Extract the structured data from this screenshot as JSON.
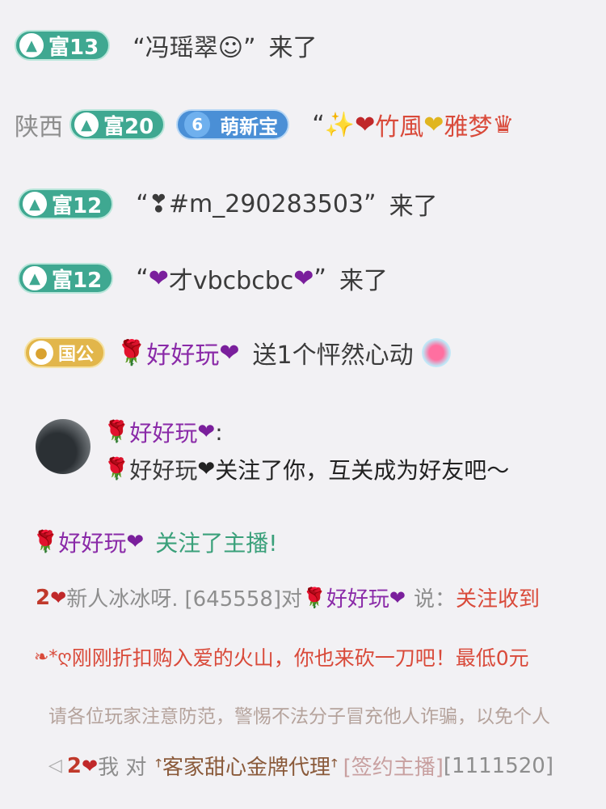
{
  "rows": {
    "r1": {
      "badge": "富13",
      "name": "“冯瑶翠☺”",
      "suffix": "来了"
    },
    "r2": {
      "region": "陕西",
      "badge": "富20",
      "fan_level": "6",
      "fan_name": "萌新宝",
      "name_prefix": "“✨",
      "name_a": "竹風",
      "name_b": "雅梦",
      "crown": "♛"
    },
    "r3": {
      "badge": "富12",
      "name": "“❣#m_290283503”",
      "suffix": "来了"
    },
    "r4": {
      "badge": "富12",
      "quote_open": "“",
      "name": "才vbcbcbc",
      "quote_close": "”",
      "suffix": "来了"
    },
    "r5": {
      "badge": "国公",
      "name": "好好玩",
      "action": "送1个怦然心动"
    },
    "chat": {
      "name": "好好玩",
      "colon": ":",
      "message": "关注了你，互关成为好友吧～"
    },
    "follow": {
      "name": "好好玩",
      "action": "关注了主播!"
    },
    "msg1": {
      "level": "2",
      "user": "新人冰冰呀.",
      "uid": "[645558]对",
      "target": "好好玩",
      "say": "说：",
      "content": "关注收到"
    },
    "msg2": {
      "icons": "❧*ღ",
      "content": "刚刚折扣购入爱的火山，你也来砍一刀吧！最低0元"
    },
    "notice": {
      "text": "请各位玩家注意防范，警惕不法分子冒充他人诈骗，以免个人"
    },
    "msg3": {
      "level": "2",
      "me": "我 对",
      "target": "ꜛ客家甜心金牌代理ꜛ",
      "role": "[签约主播]",
      "uid": "[1111520]"
    }
  }
}
